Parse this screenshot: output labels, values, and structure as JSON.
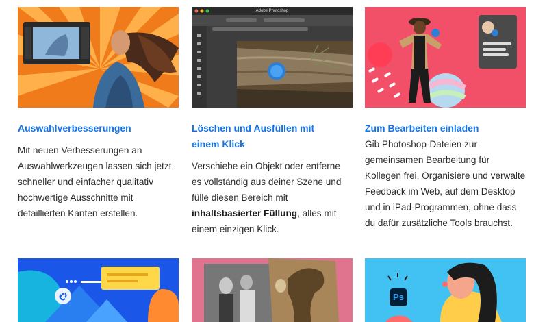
{
  "cards": [
    {
      "title": "Auswahlverbesserungen",
      "description": "Mit neuen Verbesserungen an Auswahlwerkzeugen lassen sich jetzt schneller und einfacher qualitativ hochwertige Ausschnitte mit detaillierten Kanten erstellen.",
      "image_icon": "selection-improvements-illustration"
    },
    {
      "title": "Löschen und Ausfüllen mit einem Klick",
      "description_before": "Verschiebe ein Objekt oder entferne es vollständig aus deiner Szene und fülle diesen Bereich mit ",
      "description_bold": "inhaltsbasierter Füllung",
      "description_after": ", alles mit einem einzigen Klick.",
      "app_window_title": "Adobe Photoshop",
      "image_icon": "content-aware-fill-screenshot"
    },
    {
      "title": "Zum Bearbeiten einladen",
      "description": "Gib Photoshop-Dateien zur gemeinsamen Bearbeitung für Kollegen frei. Organisiere und verwalte Feedback im Web, auf dem Desktop und in iPad-Programmen, ohne dass du dafür zusätzliche Tools brauchst.",
      "image_icon": "invite-to-edit-illustration"
    }
  ],
  "bottom_row": [
    {
      "image_icon": "collaboration-link-illustration"
    },
    {
      "image_icon": "photo-restoration-illustration"
    },
    {
      "image_icon": "photoshop-app-illustration",
      "app_badge": "Ps"
    }
  ]
}
